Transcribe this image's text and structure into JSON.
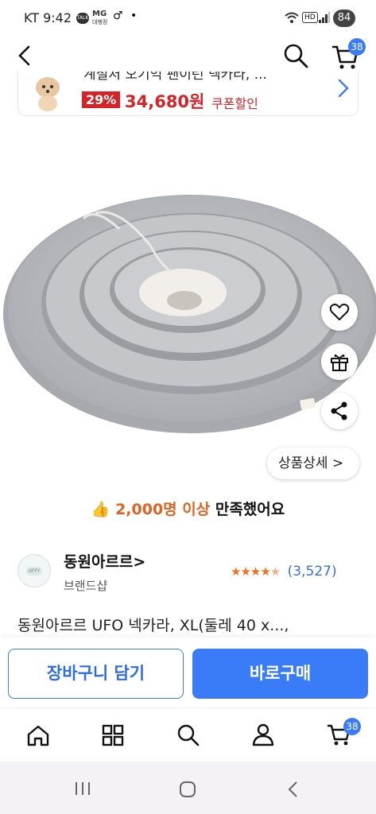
{
  "status": {
    "time": "KT 9:42",
    "carrier_mini": "MG",
    "carrier_mini_sub": "대행정",
    "talk_badge": "TALK",
    "battery": "84",
    "network_badge": "HD"
  },
  "nav": {
    "cart_count": "38"
  },
  "promo": {
    "title": "계절처 오기억 팬이런 넥카라, ...",
    "discount": "29%",
    "price": "34,680원",
    "coupon": "쿠폰할인"
  },
  "product": {
    "detail_button": "상품상세 >",
    "tag": "UFO"
  },
  "satisfaction": {
    "count": "2,000명 이상",
    "suffix": " 만족했어요"
  },
  "brand": {
    "name": "동원아르르>",
    "sub": "브랜드샵",
    "logo_text": "UFFY",
    "rating_stars": 4.5,
    "review_count": "(3,527)"
  },
  "product_title": "동원아르르 UFO 넥카라, XL(둘레 40 x...,",
  "actions": {
    "cart": "장바구니 담기",
    "buy": "바로구매"
  },
  "tabbar": {
    "cart_count": "38"
  },
  "colors": {
    "accent": "#3a7cf7",
    "price_red": "#d92228",
    "highlight_orange": "#e0631f"
  }
}
